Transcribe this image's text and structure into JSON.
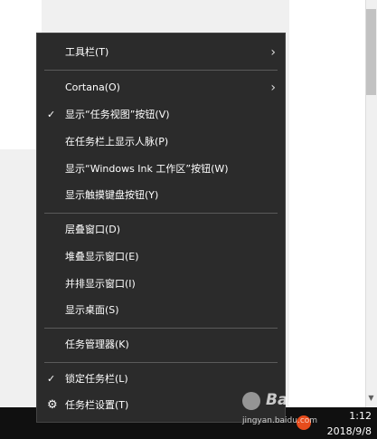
{
  "menu": {
    "items": [
      {
        "label": "工具栏(T)",
        "has_submenu": true,
        "checked": false
      },
      {
        "label": "Cortana(O)",
        "has_submenu": true,
        "checked": false
      },
      {
        "label": "显示“任务视图”按钮(V)",
        "has_submenu": false,
        "checked": true
      },
      {
        "label": "在任务栏上显示人脉(P)",
        "has_submenu": false,
        "checked": false
      },
      {
        "label": "显示“Windows Ink 工作区”按钮(W)",
        "has_submenu": false,
        "checked": false
      },
      {
        "label": "显示触摸键盘按钮(Y)",
        "has_submenu": false,
        "checked": false
      },
      {
        "label": "层叠窗口(D)",
        "has_submenu": false,
        "checked": false
      },
      {
        "label": "堆叠显示窗口(E)",
        "has_submenu": false,
        "checked": false
      },
      {
        "label": "并排显示窗口(I)",
        "has_submenu": false,
        "checked": false
      },
      {
        "label": "显示桌面(S)",
        "has_submenu": false,
        "checked": false
      },
      {
        "label": "任务管理器(K)",
        "has_submenu": false,
        "checked": false
      },
      {
        "label": "锁定任务栏(L)",
        "has_submenu": false,
        "checked": true
      },
      {
        "label": "任务栏设置(T)",
        "has_submenu": false,
        "checked": false,
        "icon": "gear-icon"
      }
    ],
    "check_glyph": "✓",
    "arrow_glyph": "›",
    "gear_glyph": "⚙"
  },
  "taskbar": {
    "time": "1:12",
    "date": "2018/9/8"
  },
  "watermark": {
    "main": "Bai 经验",
    "sub": "jingyan.baidu.com"
  },
  "colors": {
    "menu_bg": "#2b2b2b",
    "taskbar_bg": "#101010",
    "menu_text": "#ffffff"
  }
}
